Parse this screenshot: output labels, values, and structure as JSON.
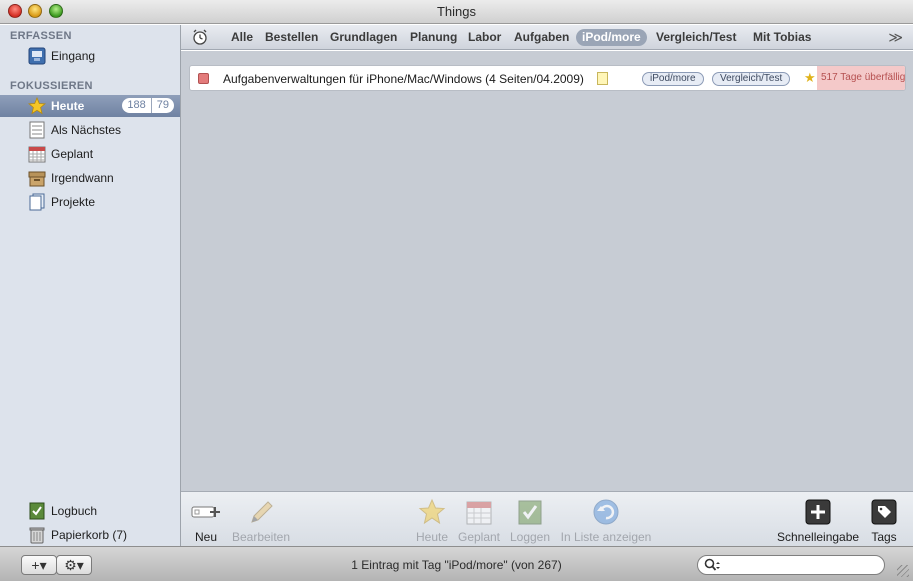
{
  "window": {
    "title": "Things"
  },
  "sidebar": {
    "sections": [
      {
        "title": "ERFASSEN"
      },
      {
        "title": "FOKUSSIEREN"
      }
    ],
    "items": [
      {
        "label": "Eingang",
        "icon": "inbox-icon"
      },
      {
        "label": "Heute",
        "icon": "star-icon",
        "badge_total": "188",
        "badge_due": "79",
        "active": true
      },
      {
        "label": "Als Nächstes",
        "icon": "next-list-icon"
      },
      {
        "label": "Geplant",
        "icon": "calendar-icon"
      },
      {
        "label": "Irgendwann",
        "icon": "archive-box-icon"
      },
      {
        "label": "Projekte",
        "icon": "projects-icon"
      }
    ],
    "bottom_items": [
      {
        "label": "Logbuch",
        "icon": "logbook-icon"
      },
      {
        "label": "Papierkorb (7)",
        "icon": "trash-icon"
      }
    ]
  },
  "tagbar": {
    "tags": [
      "Alle",
      "Bestellen",
      "Grundlagen",
      "Planung",
      "Labor",
      "Aufgaben",
      "iPod/more",
      "Vergleich/Test",
      "Mit Tobias"
    ],
    "selected": "iPod/more",
    "more_symbol": "≫"
  },
  "tasks": [
    {
      "title": "Aufgabenverwaltungen für iPhone/Mac/Windows (4 Seiten/04.2009)",
      "tags": [
        "iPod/more",
        "Vergleich/Test"
      ],
      "starred": true,
      "due_text": "517 Tage überfällig"
    }
  ],
  "toolbar": {
    "new_label": "Neu",
    "edit_label": "Bearbeiten",
    "today_label": "Heute",
    "scheduled_label": "Geplant",
    "log_label": "Loggen",
    "show_in_list_label": "In Liste anzeigen",
    "quick_entry_label": "Schnelleingabe",
    "tags_label": "Tags"
  },
  "statusbar": {
    "add_symbol": "+▾",
    "gear_symbol": "⚙▾",
    "text": "1 Eintrag mit Tag \"iPod/more\" (von 267)",
    "search_symbol": "⚲",
    "search_value": "",
    "search_placeholder": ""
  },
  "colors": {
    "sidebar_bg": "#dde3ec",
    "selection": "#7487a7",
    "main_bg": "#c7ccd4",
    "overdue_bg": "#f4c9c9",
    "overdue_text": "#b55050"
  }
}
